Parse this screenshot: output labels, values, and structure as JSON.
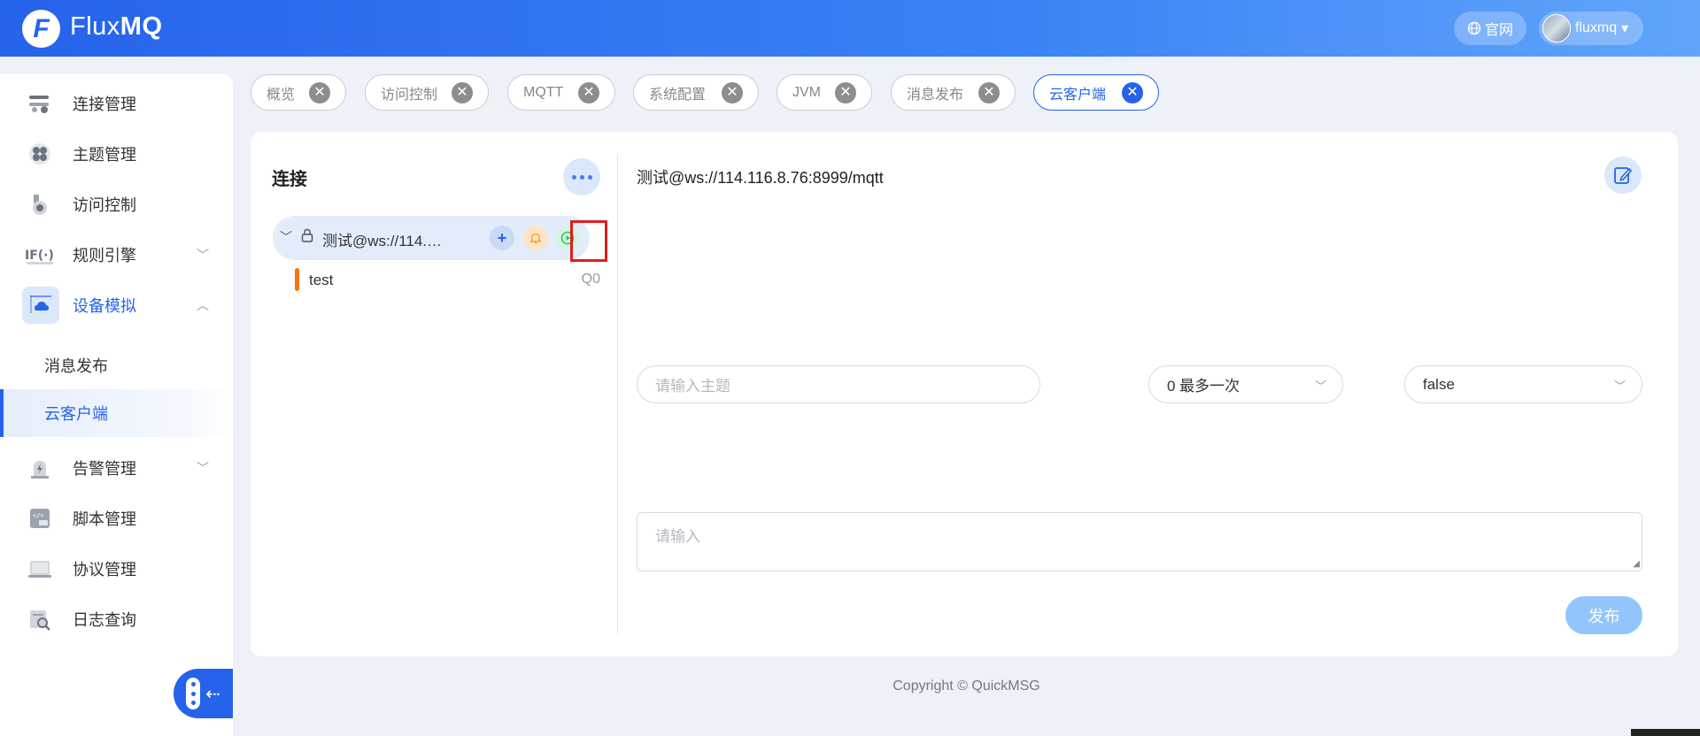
{
  "header": {
    "logo_letter": "F",
    "brand_prefix": "Flux",
    "brand_suffix": "MQ",
    "official_label": "官网",
    "user_name": "fluxmq",
    "user_caret": "▾"
  },
  "sidebar": {
    "items": [
      {
        "label": "连接管理",
        "icon": "link-settings-icon"
      },
      {
        "label": "主题管理",
        "icon": "topic-icon"
      },
      {
        "label": "访问控制",
        "icon": "access-control-icon"
      },
      {
        "label": "规则引擎",
        "icon": "rule-engine-icon",
        "arrow": "﹀"
      },
      {
        "label": "设备模拟",
        "icon": "cloud-device-icon",
        "arrow": "︿"
      },
      {
        "label": "告警管理",
        "icon": "alarm-icon",
        "arrow": "﹀"
      },
      {
        "label": "脚本管理",
        "icon": "script-icon"
      },
      {
        "label": "协议管理",
        "icon": "protocol-icon"
      },
      {
        "label": "日志查询",
        "icon": "log-search-icon"
      }
    ],
    "sub_items": [
      {
        "label": "消息发布"
      },
      {
        "label": "云客户端"
      }
    ],
    "collapse_arrow": "⇠"
  },
  "tabs": [
    {
      "label": "概览"
    },
    {
      "label": "访问控制"
    },
    {
      "label": "MQTT"
    },
    {
      "label": "系统配置"
    },
    {
      "label": "JVM"
    },
    {
      "label": "消息发布"
    },
    {
      "label": "云客户端"
    }
  ],
  "tab_close_glyph": "✕",
  "connections": {
    "title": "连接",
    "list": [
      {
        "name": "测试@ws://114.116.8.76:8999/mqtt",
        "subscriptions": [
          {
            "topic": "test",
            "qos": "Q0"
          }
        ]
      }
    ],
    "chevron": "﹀",
    "lock_glyph": "🔒",
    "add_glyph": "+",
    "bell_glyph": "🔔",
    "play_glyph": "▶"
  },
  "publish": {
    "target": "测试@ws://114.116.8.76:8999/mqtt",
    "topic_placeholder": "请输入主题",
    "qos_value": "0 最多一次",
    "retain_value": "false",
    "payload_placeholder": "请输入",
    "publish_label": "发布",
    "select_arrow": "﹀"
  },
  "footer": {
    "copyright": "Copyright © QuickMSG"
  },
  "colors": {
    "primary": "#2563eb",
    "highlight": "#e11d1d",
    "subscription_bar": "#f97316"
  }
}
